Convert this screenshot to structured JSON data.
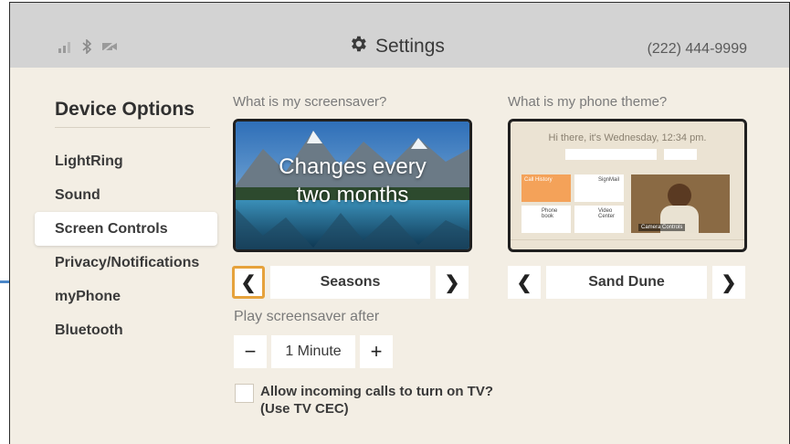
{
  "header": {
    "title": "Settings",
    "phone_number": "(222) 444-9999",
    "icons": [
      "signal-icon",
      "bluetooth-icon",
      "muted-video-icon",
      "gear-icon"
    ]
  },
  "sidebar": {
    "title": "Device Options",
    "items": [
      {
        "label": "LightRing",
        "active": false
      },
      {
        "label": "Sound",
        "active": false
      },
      {
        "label": "Screen Controls",
        "active": true
      },
      {
        "label": "Privacy/Notifications",
        "active": false
      },
      {
        "label": "myPhone",
        "active": false
      },
      {
        "label": "Bluetooth",
        "active": false
      }
    ]
  },
  "screensaver": {
    "question": "What is my screensaver?",
    "overlay_line1": "Changes every",
    "overlay_line2": "two months",
    "selected": "Seasons",
    "prev_icon": "chevron-left-icon",
    "next_icon": "chevron-right-icon"
  },
  "theme": {
    "question": "What is my phone theme?",
    "preview_greeting": "Hi there, it's Wednesday, 12:34 pm.",
    "preview_tiles": [
      "Call History",
      "SignMail",
      "Phone book",
      "Video Center"
    ],
    "preview_camera_label": "Camera Controls",
    "selected": "Sand Dune"
  },
  "screensaver_timer": {
    "label": "Play screensaver after",
    "value": "1 Minute",
    "minus": "−",
    "plus": "+"
  },
  "cec": {
    "label_line1": "Allow incoming calls to turn on TV?",
    "label_line2": "(Use TV CEC)",
    "checked": false
  },
  "colors": {
    "background": "#f3eee4",
    "topbar": "#d3d3d3",
    "focus": "#e6a23c",
    "pointer": "#4a86c8"
  }
}
